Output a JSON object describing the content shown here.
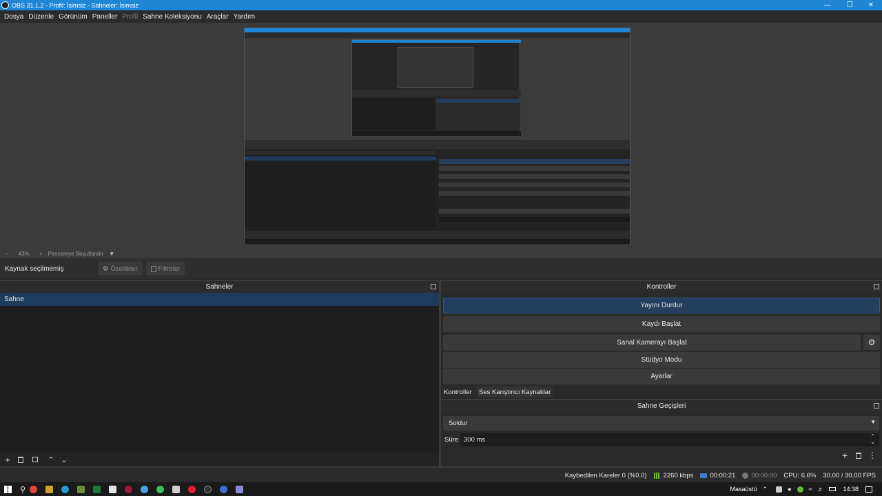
{
  "window": {
    "title": "OBS 31.1.2 - Profil: İsimsiz - Sahneler: İsimsiz"
  },
  "menu": {
    "items": [
      "Dosya",
      "Düzenle",
      "Görünüm",
      "Paneller",
      "Profil",
      "Sahne Koleksiyonu",
      "Araçlar",
      "Yardım"
    ]
  },
  "preview": {
    "zoom_label": "43%",
    "fit_label": "Pencereye Boyutlandır"
  },
  "source_toolbar": {
    "status": "Kaynak seçilmemiş",
    "properties_label": "Özellikler",
    "filters_label": "Filtreler"
  },
  "scenes": {
    "title": "Sahneler",
    "items": [
      "Sahne"
    ]
  },
  "controls": {
    "title": "Kontroller",
    "stop_stream": "Yayını Durdur",
    "start_record": "Kaydı Başlat",
    "start_virtualcam": "Sanal Kamerayı Başlat",
    "studio_mode": "Stüdyo Modu",
    "settings": "Ayarlar"
  },
  "tabs": [
    "Kontroller",
    "Ses Karıştırıcı",
    "Kaynaklar"
  ],
  "transitions": {
    "title": "Sahne Geçişleri",
    "selected": "Soldur",
    "duration_label": "Süre",
    "duration_value": "300 ms"
  },
  "status": {
    "dropped_frames": "Kaybedilen Kareler 0 (%0.0)",
    "bitrate": "2260 kbps",
    "stream_time": "00:00:21",
    "record_time": "00:00:00",
    "cpu": "CPU: 6.6%",
    "fps": "30.00 / 30.00 FPS"
  },
  "taskbar": {
    "desktop_label": "Masaüstü",
    "clock": "14:38"
  },
  "colors": {
    "titlebar": "#1f86d6",
    "selection": "#1d3b5c",
    "bitrate_green": "#5fbf3a"
  }
}
